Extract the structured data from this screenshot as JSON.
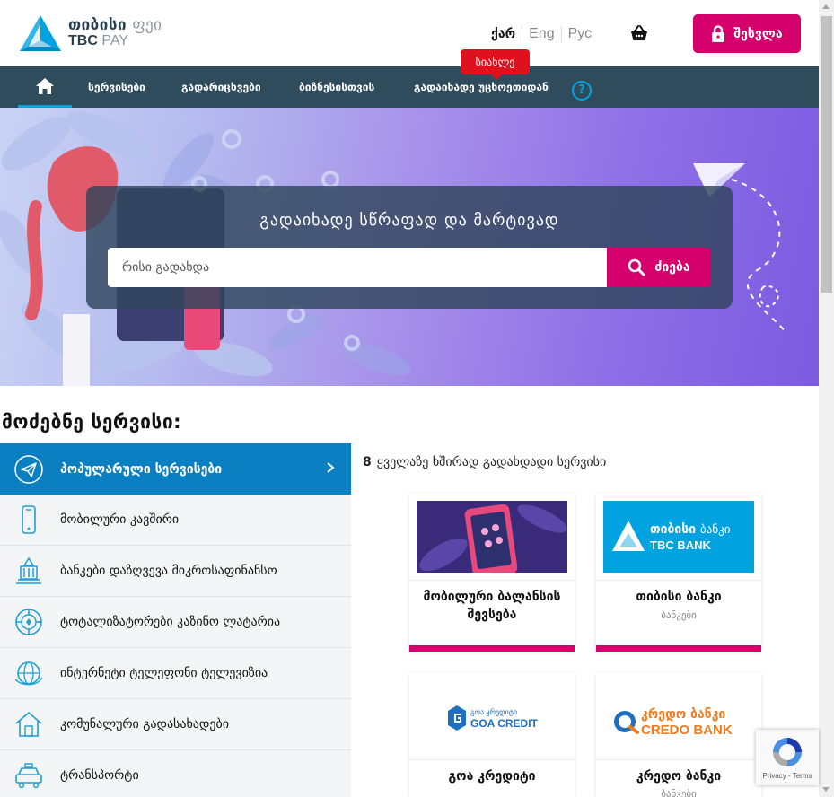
{
  "header": {
    "logo_line1_main": "თიბისი",
    "logo_line1_sub": "ფეი",
    "logo_line2_main": "TBC",
    "logo_line2_sub": "PAY",
    "languages": [
      "ქარ",
      "Eng",
      "Рус"
    ],
    "login_label": "შესვლა",
    "new_badge": "სიახლე"
  },
  "nav": {
    "items": [
      "სერვისები",
      "გადარიცხვები",
      "ბიზნესისთვის",
      "გადაიხადე უცხოეთიდან"
    ],
    "help": "?"
  },
  "hero": {
    "title": "გადაიხადე სწრაფად და მარტივად",
    "search_placeholder": "რისი გადახდა",
    "search_button": "ძიება"
  },
  "services": {
    "heading": "მოძებნე სერვისი:",
    "categories": [
      {
        "label": "პოპულარული სერვისები",
        "icon": "paper-plane-icon"
      },
      {
        "label": "მობილური კავშირი",
        "icon": "mobile-phone-icon"
      },
      {
        "label": "ბანკები დაზღვევა მიკროსაფინანსო",
        "icon": "bank-building-icon"
      },
      {
        "label": "ტოტალიზატორები კაზინო ლატარია",
        "icon": "casino-chip-icon"
      },
      {
        "label": "ინტერნეტი ტელეფონი ტელევიზია",
        "icon": "globe-icon"
      },
      {
        "label": "კომუნალური გადასახადები",
        "icon": "house-icon"
      },
      {
        "label": "ტრანსპორტი",
        "icon": "taxi-car-icon"
      }
    ],
    "count": "8",
    "count_text": "ყველაზე ხშირად გადახდადი სერვისი"
  },
  "cards": [
    {
      "title": "მობილური ბალანსის შევსება",
      "subtitle": ""
    },
    {
      "title": "თიბისი ბანკი",
      "subtitle": "ბანკები",
      "logo_main": "თიბისი",
      "logo_sub": "ბანკი",
      "logo_en": "TBC BANK"
    },
    {
      "title": "გოა კრედიტი",
      "subtitle": "",
      "logo_ka": "გოა კრედიტი",
      "logo_en": "GOA CREDIT"
    },
    {
      "title": "კრედო ბანკი",
      "subtitle": "ბანკები",
      "logo_ka": "კრედო ბანკი",
      "logo_en": "CREDO BANK"
    }
  ],
  "recaptcha": {
    "terms": "Privacy - Terms"
  },
  "colors": {
    "brand_pink": "#d6006c",
    "nav_bg": "#2f4c5d",
    "accent_blue": "#00a3e0",
    "active_blue": "#0a7fc2"
  }
}
